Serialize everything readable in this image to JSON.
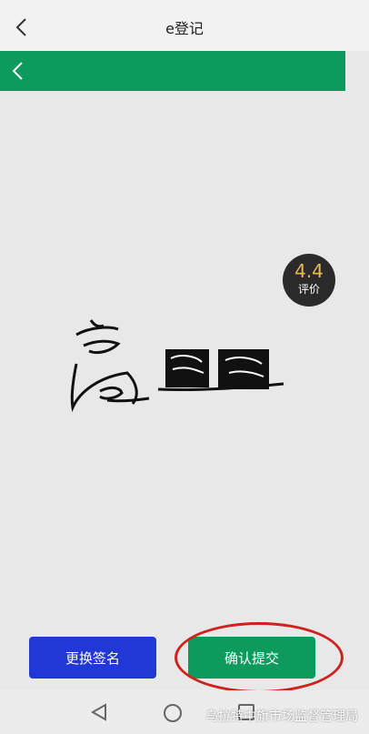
{
  "header": {
    "title": "e登记"
  },
  "rating": {
    "score": "4.4",
    "label": "评价"
  },
  "buttons": {
    "change_signature": "更换签名",
    "confirm_submit": "确认提交"
  },
  "watermark": "乌拉特中旗市场监督管理局",
  "colors": {
    "green": "#0d9a5d",
    "blue": "#2238d6",
    "annotation_red": "#d0211d"
  }
}
